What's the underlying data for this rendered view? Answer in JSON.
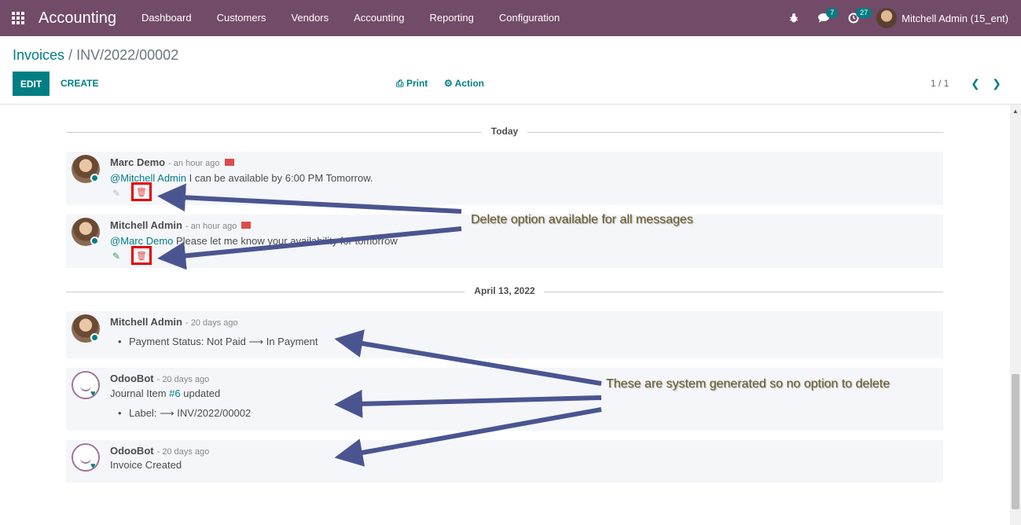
{
  "nav": {
    "brand": "Accounting",
    "menu": [
      "Dashboard",
      "Customers",
      "Vendors",
      "Accounting",
      "Reporting",
      "Configuration"
    ],
    "messages_badge": "7",
    "activities_badge": "27",
    "user": "Mitchell Admin (15_ent)",
    "icons": [
      "apps-grid-icon",
      "bug-icon",
      "chat-icon",
      "clock-icon"
    ]
  },
  "control": {
    "breadcrumb_root": "Invoices",
    "breadcrumb_sep": "/",
    "breadcrumb_current": "INV/2022/00002",
    "edit": "EDIT",
    "create": "CREATE",
    "print": "Print",
    "action": "Action",
    "pager": "1 / 1"
  },
  "chatter": {
    "separators": [
      "Today",
      "April 13, 2022"
    ],
    "messages": [
      {
        "author": "Marc Demo",
        "ago": "- an hour ago",
        "mention": "@Mitchell Admin",
        "text": " I can be available by 6:00 PM Tomorrow."
      },
      {
        "author": "Mitchell Admin",
        "ago": "- an hour ago",
        "mention": "@Marc Demo",
        "text": " Please let me know your availability for tomorrow"
      },
      {
        "author": "Mitchell Admin",
        "ago": "- 20 days ago",
        "bullet": "Payment Status: Not Paid ⟶ In Payment"
      },
      {
        "author": "OdooBot",
        "ago": "- 20 days ago",
        "text_before": "Journal Item ",
        "link": "#6",
        "text_after": " updated",
        "bullet": "Label: ⟶ INV/2022/00002"
      },
      {
        "author": "OdooBot",
        "ago": "- 20 days ago",
        "text": "Invoice Created"
      }
    ]
  },
  "annotations": {
    "delete_note": "Delete option available for all messages",
    "system_note": "These are system generated so no option to delete",
    "arrow_color": "#4a5590",
    "highlight_color": "#e00000"
  },
  "colors": {
    "nav_bg": "#714b67",
    "primary": "#017e84",
    "message_bg": "#f5f6f9"
  }
}
